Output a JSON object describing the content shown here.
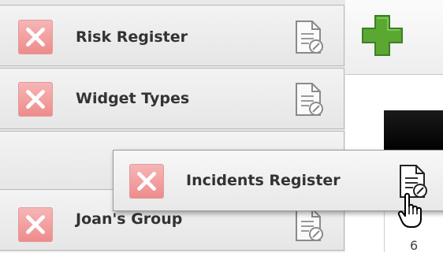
{
  "list": {
    "items": [
      {
        "label": "Risk Register"
      },
      {
        "label": "Widget Types"
      },
      {
        "label": ""
      },
      {
        "label": "Joan's Group"
      }
    ]
  },
  "dragging_item": {
    "label": "Incidents Register"
  },
  "grid": {
    "cell_value": "6"
  },
  "icons": {
    "delete": "delete-x-icon",
    "edit": "document-edit-icon",
    "add": "green-plus-icon",
    "cursor": "hand-pointer-icon"
  },
  "colors": {
    "delete_fill": "#ee8b8b",
    "add_green": "#5aa832"
  }
}
